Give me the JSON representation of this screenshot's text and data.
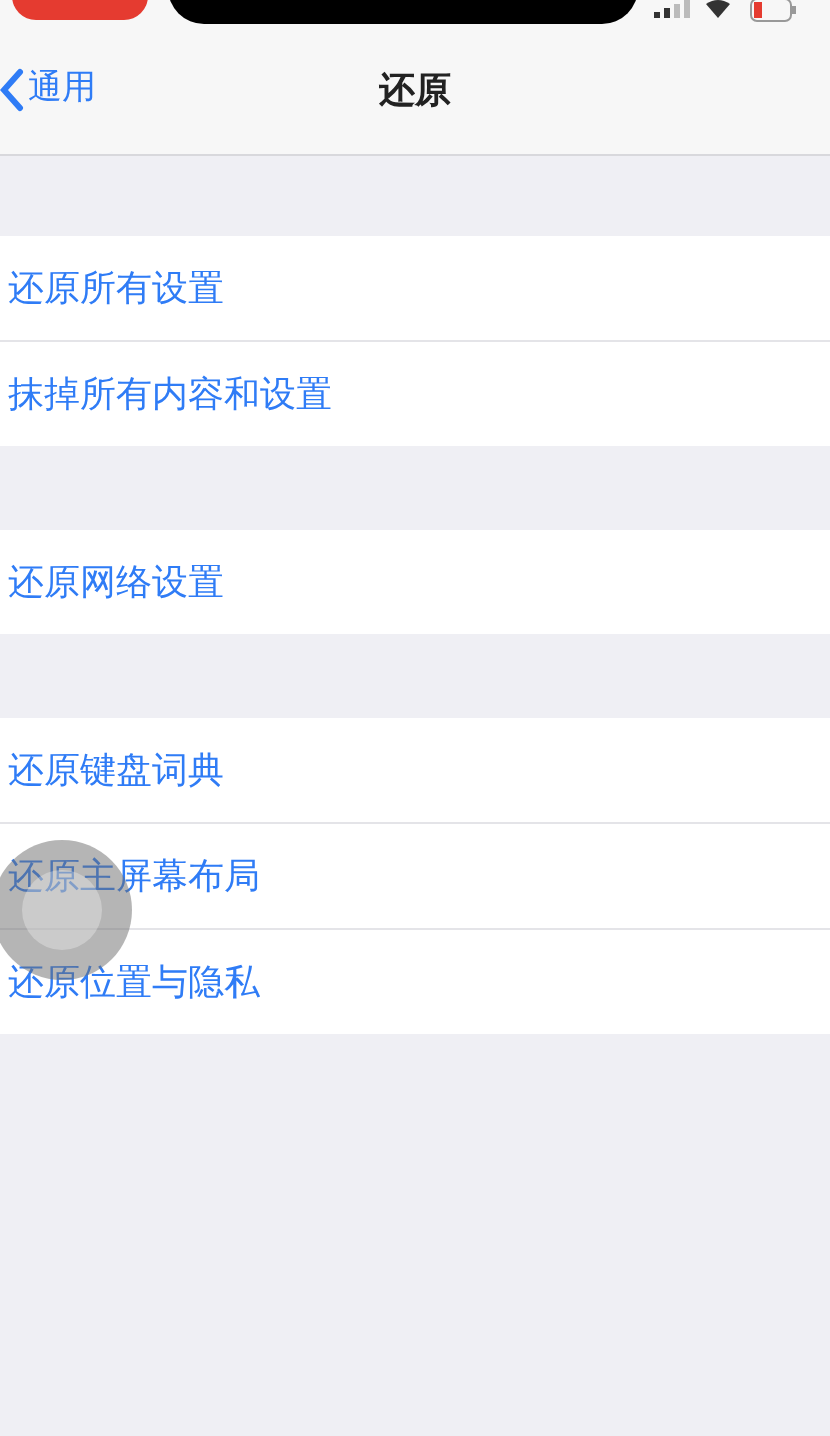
{
  "nav": {
    "back": "通用",
    "title": "还原"
  },
  "groups": [
    {
      "items": [
        "还原所有设置",
        "抹掉所有内容和设置"
      ]
    },
    {
      "items": [
        "还原网络设置"
      ]
    },
    {
      "items": [
        "还原键盘词典",
        "还原主屏幕布局",
        "还原位置与隐私"
      ]
    }
  ]
}
